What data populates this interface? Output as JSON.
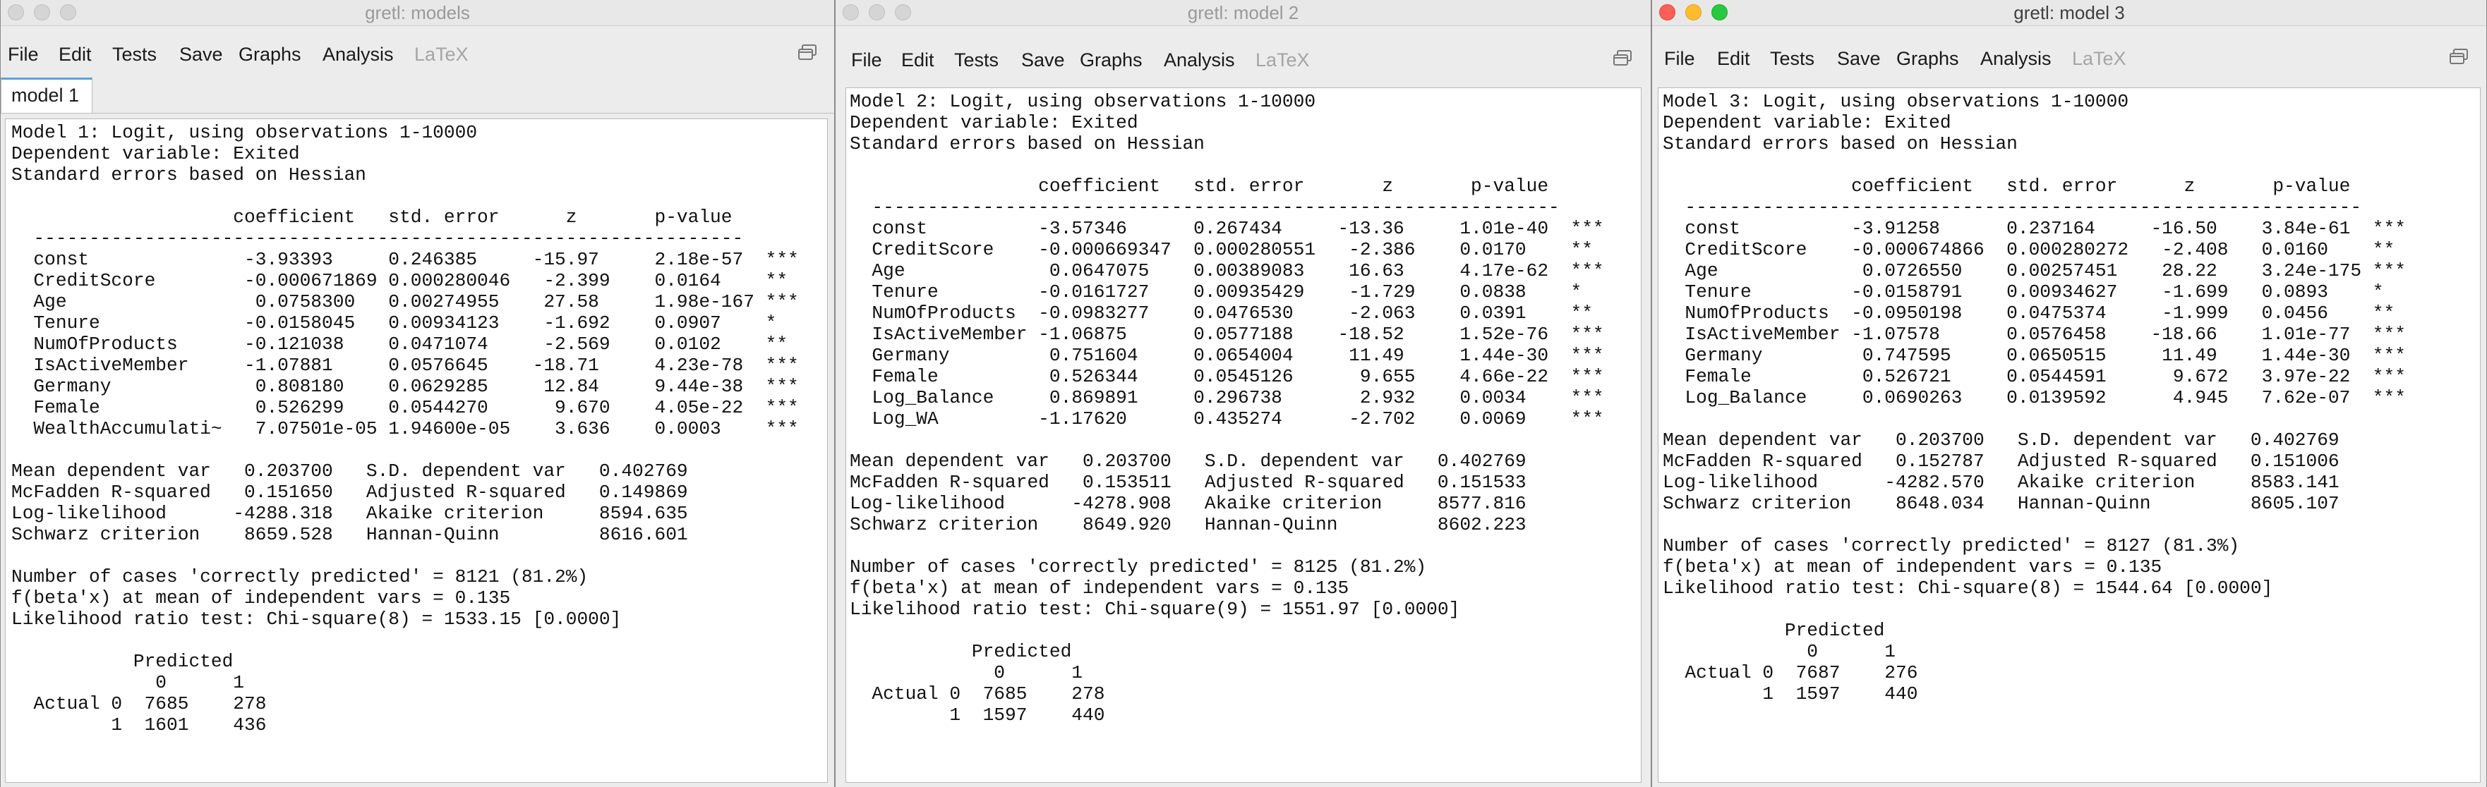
{
  "windows": [
    {
      "title": "gretl: models",
      "menu": [
        "File",
        "Edit",
        "Tests",
        "Save",
        "Graphs",
        "Analysis",
        "LaTeX"
      ],
      "tab_label": "model 1",
      "output": "Model 1: Logit, using observations 1-10000\nDependent variable: Exited\nStandard errors based on Hessian\n\n                    coefficient   std. error      z       p-value \n  ----------------------------------------------------------------\n  const              -3.93393     0.246385     -15.97     2.18e-57  ***\n  CreditScore        -0.000671869 0.000280046   -2.399    0.0164    **\n  Age                 0.0758300   0.00274955    27.58     1.98e-167 ***\n  Tenure             -0.0158045   0.00934123    -1.692    0.0907    *\n  NumOfProducts      -0.121038    0.0471074     -2.569    0.0102    **\n  IsActiveMember     -1.07881     0.0576645    -18.71     4.23e-78  ***\n  Germany             0.808180    0.0629285     12.84     9.44e-38  ***\n  Female              0.526299    0.0544270      9.670    4.05e-22  ***\n  WealthAccumulati~   7.07501e-05 1.94600e-05    3.636    0.0003    ***\n\nMean dependent var   0.203700   S.D. dependent var   0.402769\nMcFadden R-squared   0.151650   Adjusted R-squared   0.149869\nLog-likelihood      -4288.318   Akaike criterion     8594.635\nSchwarz criterion    8659.528   Hannan-Quinn         8616.601\n\nNumber of cases 'correctly predicted' = 8121 (81.2%)\nf(beta'x) at mean of independent vars = 0.135\nLikelihood ratio test: Chi-square(8) = 1533.15 [0.0000]\n\n           Predicted\n             0      1\n  Actual 0  7685    278\n         1  1601    436"
    },
    {
      "title": "gretl: model 2",
      "menu": [
        "File",
        "Edit",
        "Tests",
        "Save",
        "Graphs",
        "Analysis",
        "LaTeX"
      ],
      "output": "Model 2: Logit, using observations 1-10000\nDependent variable: Exited\nStandard errors based on Hessian\n\n                 coefficient   std. error       z       p-value \n  --------------------------------------------------------------\n  const          -3.57346      0.267434     -13.36     1.01e-40  ***\n  CreditScore    -0.000669347  0.000280551   -2.386    0.0170    **\n  Age             0.0647075    0.00389083    16.63     4.17e-62  ***\n  Tenure         -0.0161727    0.00935429    -1.729    0.0838    *\n  NumOfProducts  -0.0983277    0.0476530     -2.063    0.0391    **\n  IsActiveMember -1.06875      0.0577188    -18.52     1.52e-76  ***\n  Germany         0.751604     0.0654004     11.49     1.44e-30  ***\n  Female          0.526344     0.0545126      9.655    4.66e-22  ***\n  Log_Balance     0.869891     0.296738       2.932    0.0034    ***\n  Log_WA         -1.17620      0.435274      -2.702    0.0069    ***\n\nMean dependent var   0.203700   S.D. dependent var   0.402769\nMcFadden R-squared   0.153511   Adjusted R-squared   0.151533\nLog-likelihood      -4278.908   Akaike criterion     8577.816\nSchwarz criterion    8649.920   Hannan-Quinn         8602.223\n\nNumber of cases 'correctly predicted' = 8125 (81.2%)\nf(beta'x) at mean of independent vars = 0.135\nLikelihood ratio test: Chi-square(9) = 1551.97 [0.0000]\n\n           Predicted\n             0      1\n  Actual 0  7685    278\n         1  1597    440"
    },
    {
      "title": "gretl: model 3",
      "menu": [
        "File",
        "Edit",
        "Tests",
        "Save",
        "Graphs",
        "Analysis",
        "LaTeX"
      ],
      "output": "Model 3: Logit, using observations 1-10000\nDependent variable: Exited\nStandard errors based on Hessian\n\n                 coefficient   std. error      z       p-value \n  -------------------------------------------------------------\n  const          -3.91258      0.237164     -16.50    3.84e-61  ***\n  CreditScore    -0.000674866  0.000280272   -2.408   0.0160    **\n  Age             0.0726550    0.00257451    28.22    3.24e-175 ***\n  Tenure         -0.0158791    0.00934627    -1.699   0.0893    *\n  NumOfProducts  -0.0950198    0.0475374     -1.999   0.0456    **\n  IsActiveMember -1.07578      0.0576458    -18.66    1.01e-77  ***\n  Germany         0.747595     0.0650515     11.49    1.44e-30  ***\n  Female          0.526721     0.0544591      9.672   3.97e-22  ***\n  Log_Balance     0.0690263    0.0139592      4.945   7.62e-07  ***\n\nMean dependent var   0.203700   S.D. dependent var   0.402769\nMcFadden R-squared   0.152787   Adjusted R-squared   0.151006\nLog-likelihood      -4282.570   Akaike criterion     8583.141\nSchwarz criterion    8648.034   Hannan-Quinn         8605.107\n\nNumber of cases 'correctly predicted' = 8127 (81.3%)\nf(beta'x) at mean of independent vars = 0.135\nLikelihood ratio test: Chi-square(8) = 1544.64 [0.0000]\n\n           Predicted\n             0      1\n  Actual 0  7687    276\n         1  1597    440"
    }
  ],
  "colors": {
    "close": "#fe5f57",
    "minimize": "#febc2e",
    "zoom": "#28c840",
    "tab_accent": "#5aa0e6"
  },
  "icons": [
    "window-switch-icon"
  ]
}
